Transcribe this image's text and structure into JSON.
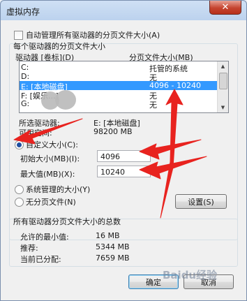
{
  "window": {
    "title": "虚拟内存",
    "close_glyph": "✕"
  },
  "auto_manage": {
    "label": "自动管理所有驱动器的分页文件大小(A)",
    "checked": false
  },
  "group_drives": {
    "title": "每个驱动器的分页文件大小",
    "col_drive": "驱动器 [卷标](D)",
    "col_size": "分页文件大小(MB)",
    "rows": [
      {
        "drive": "C:",
        "size": "托管的系统"
      },
      {
        "drive": "D:",
        "size": "无"
      },
      {
        "drive": "E:   [本地磁盘]",
        "size": "4096 - 10240"
      },
      {
        "drive": "F:   [娱乐...]",
        "size": "无"
      },
      {
        "drive": "G:",
        "size": "无"
      }
    ],
    "selected_index": 2,
    "selected_drive_label": "所选驱动器:",
    "selected_drive_value": "E:  [本地磁盘]",
    "free_space_label": "可用空间:",
    "free_space_value": "98200 MB",
    "custom_size_label": "自定义大小(C):",
    "initial_label": "初始大小(MB)(I):",
    "initial_value": "4096",
    "max_label": "最大值(MB)(X):",
    "max_value": "10240",
    "system_managed_label": "系统管理的大小(Y)",
    "no_paging_label": "无分页文件(N)",
    "set_button": "设置(S)",
    "selected_radio": "custom"
  },
  "group_total": {
    "title": "所有驱动器分页文件大小的总数",
    "min_label": "允许的最小值:",
    "min_value": "16 MB",
    "recommended_label": "推荐:",
    "recommended_value": "5344 MB",
    "allocated_label": "当前已分配:",
    "allocated_value": "7659 MB"
  },
  "buttons": {
    "ok": "确定",
    "cancel": "取消"
  },
  "watermark": "Baidu经验",
  "annotation_color": "#e8231f"
}
